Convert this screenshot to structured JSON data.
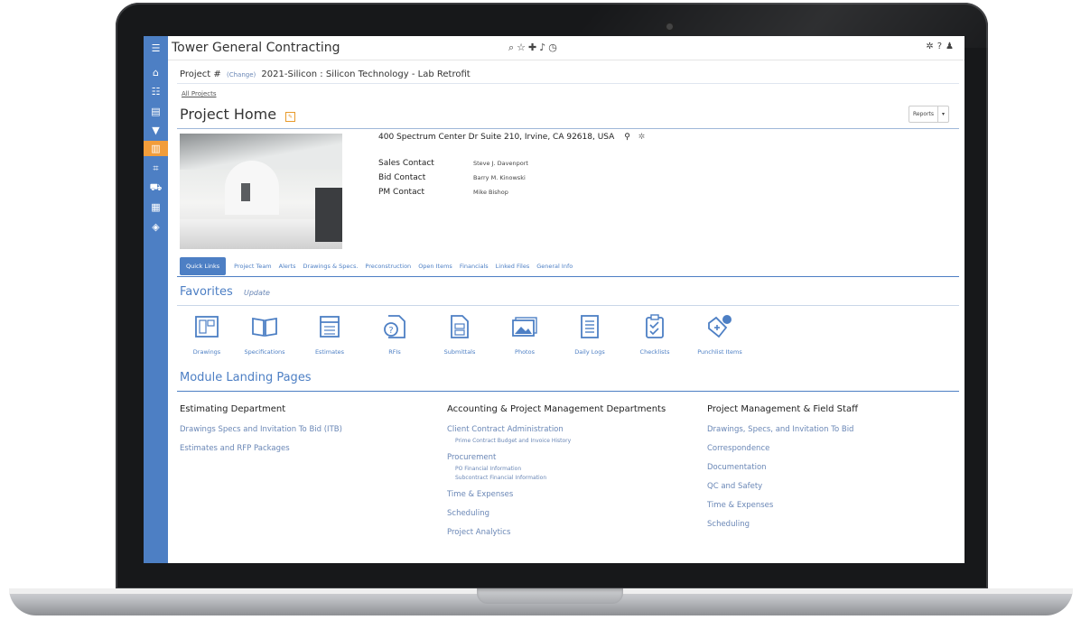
{
  "app": {
    "title": "Tower General Contracting"
  },
  "project": {
    "label": "Project #",
    "change": "(Change)",
    "name": "2021-Silicon : Silicon Technology - Lab Retrofit"
  },
  "breadcrumb": {
    "all_projects": "All Projects"
  },
  "page": {
    "title": "Project Home",
    "reports_label": "Reports"
  },
  "address": "400 Spectrum Center Dr Suite 210, Irvine, CA 92618, USA",
  "contacts": [
    {
      "label": "Sales Contact",
      "value": "Steve J. Davenport"
    },
    {
      "label": "Bid Contact",
      "value": "Barry M. Kinowski"
    },
    {
      "label": "PM Contact",
      "value": "Mike Bishop"
    }
  ],
  "tabs": [
    "Quick Links",
    "Project Team",
    "Alerts",
    "Drawings & Specs.",
    "Preconstruction",
    "Open Items",
    "Financials",
    "Linked Files",
    "General Info"
  ],
  "favorites": {
    "title": "Favorites",
    "update": "Update",
    "items": [
      "Drawings",
      "Specifications",
      "Estimates",
      "RFIs",
      "Submittals",
      "Photos",
      "Daily Logs",
      "Checklists",
      "Punchlist Items"
    ]
  },
  "modules": {
    "title": "Module Landing Pages",
    "estimating": {
      "heading": "Estimating Department",
      "links": [
        "Drawings Specs and Invitation To Bid (ITB)",
        "Estimates and RFP Packages"
      ]
    },
    "accounting": {
      "heading": "Accounting & Project Management Departments",
      "client_contract": "Client Contract Administration",
      "client_contract_sub": "Prime Contract Budget and Invoice History",
      "procurement": "Procurement",
      "procurement_sub1": "PO Financial Information",
      "procurement_sub2": "Subcontract Financial Information",
      "time": "Time & Expenses",
      "scheduling": "Scheduling",
      "analytics": "Project Analytics"
    },
    "field": {
      "heading": "Project Management & Field Staff",
      "links": [
        "Drawings, Specs, and Invitation To Bid",
        "Correspondence",
        "Documentation",
        "QC and Safety",
        "Time & Expenses",
        "Scheduling"
      ]
    }
  },
  "colors": {
    "accent": "#4d7fc4",
    "active_sidebar": "#f29d3b",
    "link": "#6a87b6"
  }
}
